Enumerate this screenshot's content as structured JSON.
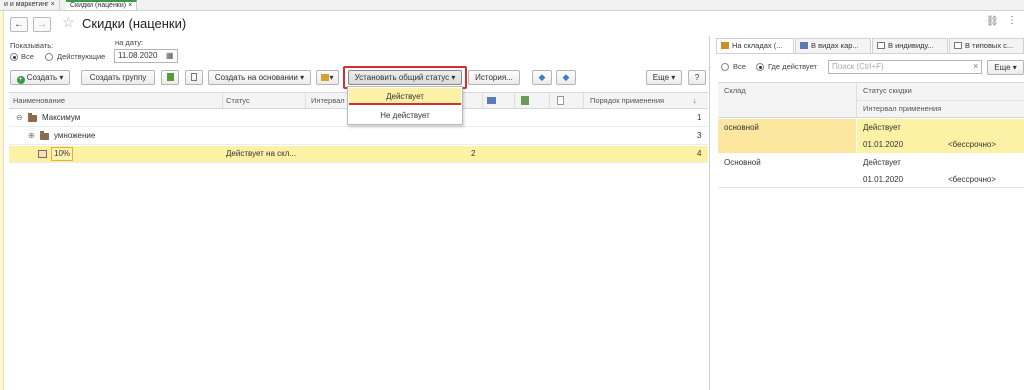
{
  "tabs": [
    {
      "label": "и и маркетинг"
    },
    {
      "label": "Скидки (наценки)"
    }
  ],
  "window": {
    "title": "Скидки (наценки)"
  },
  "filter": {
    "show_label": "Показывать:",
    "opt_all": "Все",
    "opt_active": "Действующие",
    "date_label": "на дату:",
    "date_value": "11.08.2020"
  },
  "toolbar": {
    "create": "Создать",
    "create_group": "Создать группу",
    "create_based": "Создать на основании",
    "set_status": "Установить общий статус",
    "history": "История...",
    "more": "Еще",
    "help": "?"
  },
  "status_menu": {
    "items": [
      "Действует",
      "Не действует"
    ]
  },
  "grid": {
    "columns": [
      "Наименование",
      "Статус",
      "Интервал",
      "Порядок применения"
    ],
    "rows": [
      {
        "name": "Максимум",
        "status": "",
        "num": "",
        "order": "1"
      },
      {
        "name": "умножение",
        "status": "",
        "num": "",
        "order": "3"
      },
      {
        "name": "10%",
        "status": "Действует на скл...",
        "num": "2",
        "order": "4"
      }
    ]
  },
  "right_panel": {
    "tabs": [
      "На складах (...",
      "В видах кар...",
      "В индивиду...",
      "В типовых с..."
    ],
    "opt_all": "Все",
    "opt_active": "Где действует",
    "search_placeholder": "Поиск (Ctrl+F)",
    "more": "Еще",
    "columns": {
      "warehouse": "Склад",
      "status": "Статус скидки",
      "interval": "Интервал применения"
    },
    "rows": [
      {
        "warehouse": "основной",
        "status": "Действует",
        "from": "01.01.2020",
        "to": "<бессрочно>"
      },
      {
        "warehouse": "Основной",
        "status": "Действует",
        "from": "01.01.2020",
        "to": "<бессрочно>"
      }
    ]
  },
  "colors": {
    "accent_green": "#3a9a4a",
    "highlight": "#fdf1a6",
    "menu_border": "#d03030"
  }
}
